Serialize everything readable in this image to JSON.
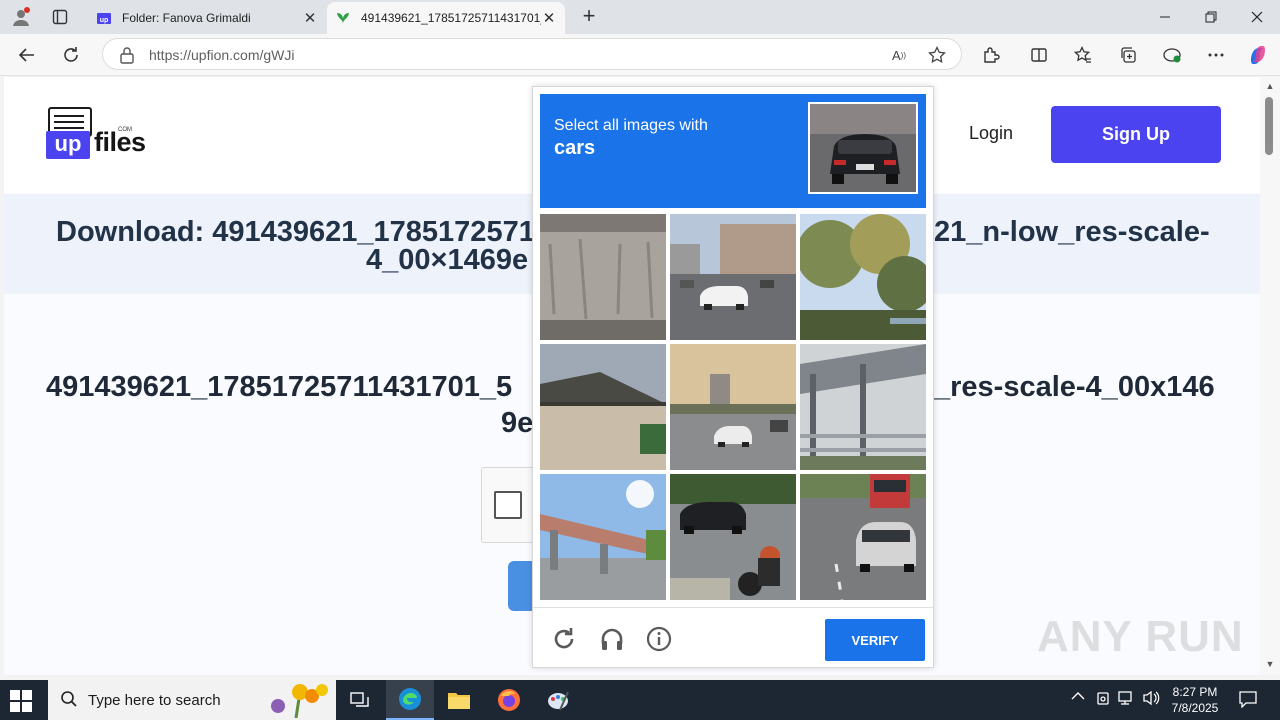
{
  "browser": {
    "tabs": [
      {
        "title": "Folder: Fanova Grimaldi",
        "active": false
      },
      {
        "title": "491439621_17851725711431701_",
        "active": true
      }
    ],
    "url": "https://upfion.com/gWJi",
    "window_controls": [
      "minimize",
      "restore",
      "close"
    ]
  },
  "site": {
    "logo_text": "files",
    "logo_badge": "up",
    "logo_com": "COM",
    "login_label": "Login",
    "signup_label": "Sign Up",
    "download_title": "Download: 491439621_17851725711431701_5…21_n-low_res-scale-4_00×1469e",
    "download_title_visible_left": "Download: 491439621_17851725711",
    "download_title_visible_right": "21_n-low_res-scale-",
    "download_title_line2_left": "4_00×1469e",
    "filename_line1_left": "491439621_17851725711431701_5",
    "filename_line1_right": "_res-scale-4_00x146",
    "filename_line2": "9e",
    "accent_color": "#4b43f0"
  },
  "captcha": {
    "instruction": "Select all images with",
    "target": "cars",
    "tiles": [
      {
        "id": 1,
        "content": "concrete wall"
      },
      {
        "id": 2,
        "content": "street with white car"
      },
      {
        "id": 3,
        "content": "trees"
      },
      {
        "id": 4,
        "content": "building roof"
      },
      {
        "id": 5,
        "content": "highway with cars"
      },
      {
        "id": 6,
        "content": "bridge railing"
      },
      {
        "id": 7,
        "content": "overpass"
      },
      {
        "id": 8,
        "content": "motorcycle and car"
      },
      {
        "id": 9,
        "content": "car and bus on road"
      }
    ],
    "verify_label": "VERIFY",
    "accent_color": "#1a73e8"
  },
  "watermark": "ANY RUN",
  "taskbar": {
    "search_placeholder": "Type here to search",
    "time": "8:27 PM",
    "date": "7/8/2025"
  }
}
